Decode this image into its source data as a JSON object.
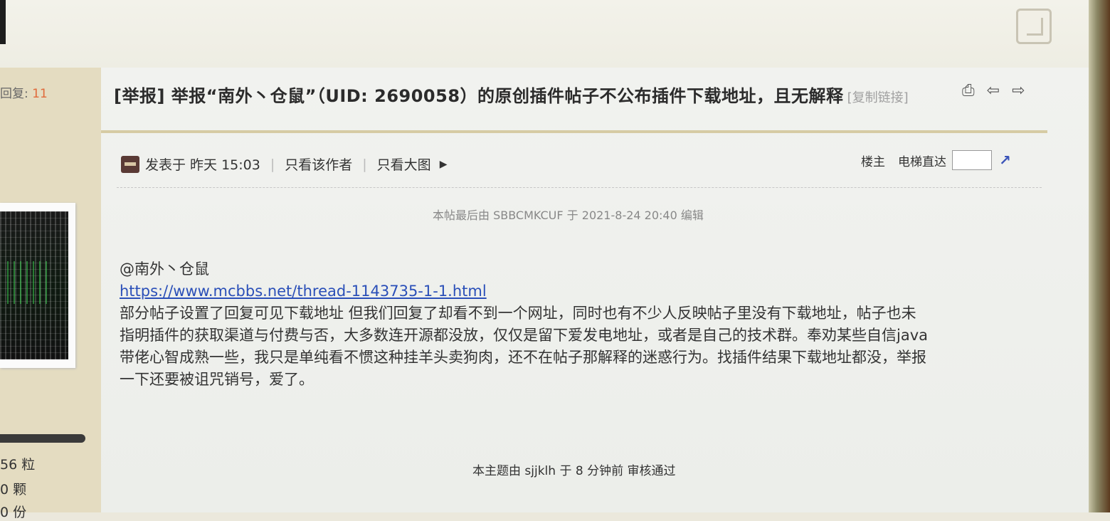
{
  "sidebar": {
    "reply_label": "回复:",
    "reply_count": "11",
    "stat_1": "56 粒",
    "stat_2": "0 颗",
    "stat_3": "0 份"
  },
  "post": {
    "title": "[举报] 举报“南外丶仓鼠”（UID: 2690058）的原创插件帖子不公布插件下载地址，且无解释",
    "copy_link": "[复制链接]",
    "posted_label": "发表于 昨天 15:03",
    "only_author": "只看该作者",
    "only_large_image": "只看大图",
    "floor_label": "楼主",
    "elevator_label": "电梯直达",
    "edit_note": "本帖最后由 SBBCMKCUF 于 2021-8-24 20:40 编辑",
    "mention": "@南外丶仓鼠",
    "link": "https://www.mcbbs.net/thread-1143735-1-1.html",
    "body_lines": [
      "部分帖子设置了回复可见下载地址 但我们回复了却看不到一个网址，同时也有不少人反映帖子里没有下载地址，帖子也未",
      "指明插件的获取渠道与付费与否，大多数连开源都没放，仅仅是留下爱发电地址，或者是自己的技术群。奉劝某些自信java",
      "带佬心智成熟一些，我只是单纯看不惯这种挂羊头卖狗肉，还不在帖子那解释的迷惑行为。找插件结果下载地址都没，举报",
      "一下还要被诅咒销号，爱了。"
    ],
    "review_note": "本主题由 sjjklh 于 8 分钟前 审核通过"
  },
  "icons": [
    "print-icon",
    "prev-thread-icon",
    "next-thread-icon",
    "goto-floor-icon",
    "author-avatar-icon"
  ]
}
